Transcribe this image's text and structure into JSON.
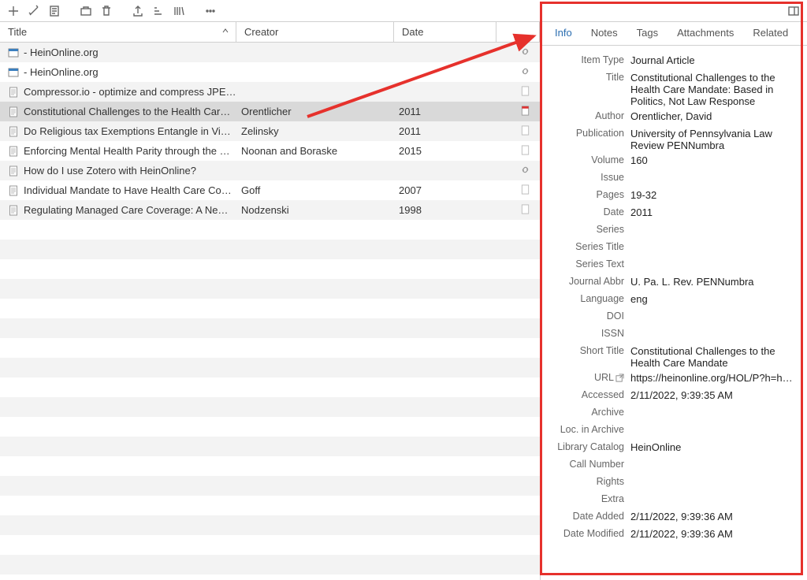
{
  "toolbar_icons": [
    "plus",
    "wand",
    "note",
    "folder",
    "trash",
    "upload",
    "feed",
    "library",
    "more",
    "panel"
  ],
  "columns": {
    "title": "Title",
    "creator": "Creator",
    "date": "Date"
  },
  "rows": [
    {
      "icon": "web",
      "title": " - HeinOnline.org",
      "creator": "",
      "date": "",
      "att": "link"
    },
    {
      "icon": "web",
      "title": " - HeinOnline.org",
      "creator": "",
      "date": "",
      "att": "link"
    },
    {
      "icon": "doc",
      "title": "Compressor.io - optimize and compress JPE…",
      "creator": "",
      "date": "",
      "att": "page"
    },
    {
      "icon": "doc",
      "title": "Constitutional Challenges to the Health Car…",
      "creator": "Orentlicher",
      "date": "2011",
      "att": "pdf",
      "selected": true
    },
    {
      "icon": "doc",
      "title": "Do Religious tax Exemptions Entangle in Vi…",
      "creator": "Zelinsky",
      "date": "2011",
      "att": "page"
    },
    {
      "icon": "doc",
      "title": "Enforcing Mental Health Parity through the …",
      "creator": "Noonan and Boraske",
      "date": "2015",
      "att": "page"
    },
    {
      "icon": "doc",
      "title": "How do I use Zotero with HeinOnline?",
      "creator": "",
      "date": "",
      "att": "link"
    },
    {
      "icon": "doc",
      "title": "Individual Mandate to Have Health Care Co…",
      "creator": "Goff",
      "date": "2007",
      "att": "page"
    },
    {
      "icon": "doc",
      "title": "Regulating Managed Care Coverage: A Ne…",
      "creator": "Nodzenski",
      "date": "1998",
      "att": "page"
    }
  ],
  "tabs": [
    "Info",
    "Notes",
    "Tags",
    "Attachments",
    "Related"
  ],
  "active_tab": 0,
  "details": [
    {
      "label": "Item Type",
      "value": "Journal Article"
    },
    {
      "label": "Title",
      "value": "Constitutional Challenges to the Health Care Mandate: Based in Politics, Not Law Response"
    },
    {
      "label": "Author",
      "value": "Orentlicher, David"
    },
    {
      "label": "Publication",
      "value": "University of Pennsylvania Law Review PENNumbra"
    },
    {
      "label": "Volume",
      "value": "160"
    },
    {
      "label": "Issue",
      "value": ""
    },
    {
      "label": "Pages",
      "value": "19-32"
    },
    {
      "label": "Date",
      "value": "2011"
    },
    {
      "label": "Series",
      "value": ""
    },
    {
      "label": "Series Title",
      "value": ""
    },
    {
      "label": "Series Text",
      "value": ""
    },
    {
      "label": "Journal Abbr",
      "value": "U. Pa. L. Rev. PENNumbra"
    },
    {
      "label": "Language",
      "value": "eng"
    },
    {
      "label": "DOI",
      "value": ""
    },
    {
      "label": "ISSN",
      "value": ""
    },
    {
      "label": "Short Title",
      "value": "Constitutional Challenges to the Health Care Mandate"
    },
    {
      "label": "URL",
      "value": "https://heinonline.org/HOL/P?h=h…",
      "url": true,
      "ellips": true
    },
    {
      "label": "Accessed",
      "value": "2/11/2022, 9:39:35 AM"
    },
    {
      "label": "Archive",
      "value": ""
    },
    {
      "label": "Loc. in Archive",
      "value": ""
    },
    {
      "label": "Library Catalog",
      "value": "HeinOnline"
    },
    {
      "label": "Call Number",
      "value": ""
    },
    {
      "label": "Rights",
      "value": ""
    },
    {
      "label": "Extra",
      "value": ""
    },
    {
      "label": "Date Added",
      "value": "2/11/2022, 9:39:36 AM"
    },
    {
      "label": "Date Modified",
      "value": "2/11/2022, 9:39:36 AM"
    }
  ]
}
